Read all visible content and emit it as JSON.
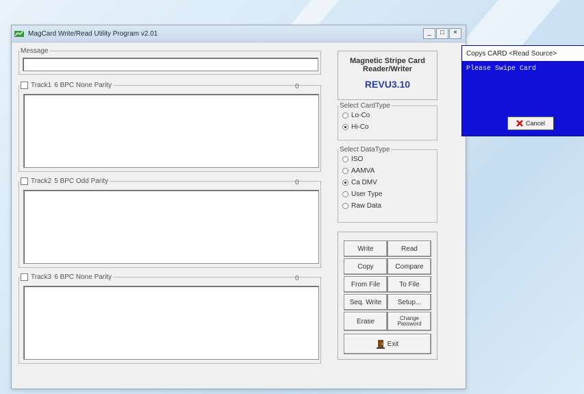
{
  "window": {
    "title": "MagCard Write/Read Utility Program v2.01",
    "minimize": "_",
    "maximize": "□",
    "close": "×"
  },
  "message": {
    "label": "Message",
    "value": ""
  },
  "tracks": [
    {
      "label": "Track1",
      "format": "6 BPC None Parity",
      "count": "0",
      "checked": false,
      "value": ""
    },
    {
      "label": "Track2",
      "format": "5 BPC Odd Parity",
      "count": "0",
      "checked": false,
      "value": ""
    },
    {
      "label": "Track3",
      "format": "6 BPC None Parity",
      "count": "0",
      "checked": false,
      "value": ""
    }
  ],
  "panel": {
    "title_line1": "Magnetic Stripe Card",
    "title_line2": "Reader/Writer",
    "revision": "REVU3.10"
  },
  "card_type": {
    "label": "Select CardType",
    "options": [
      "Lo-Co",
      "Hi-Co"
    ],
    "selected": "Hi-Co"
  },
  "data_type": {
    "label": "Select DataType",
    "options": [
      "ISO",
      "AAMVA",
      "Ca DMV",
      "User Type",
      "Raw Data"
    ],
    "selected": "Ca DMV"
  },
  "buttons": {
    "write": "Write",
    "read": "Read",
    "copy": "Copy",
    "compare": "Compare",
    "from_file": "From File",
    "to_file": "To File",
    "seq_write": "Seq. Write",
    "setup": "Setup...",
    "erase": "Erase",
    "change_password_1": "Change",
    "change_password_2": "Password",
    "exit": "Exit"
  },
  "popup": {
    "title": "Copys CARD <Read Source>",
    "message": "Please Swipe Card",
    "cancel": "Cancel"
  }
}
